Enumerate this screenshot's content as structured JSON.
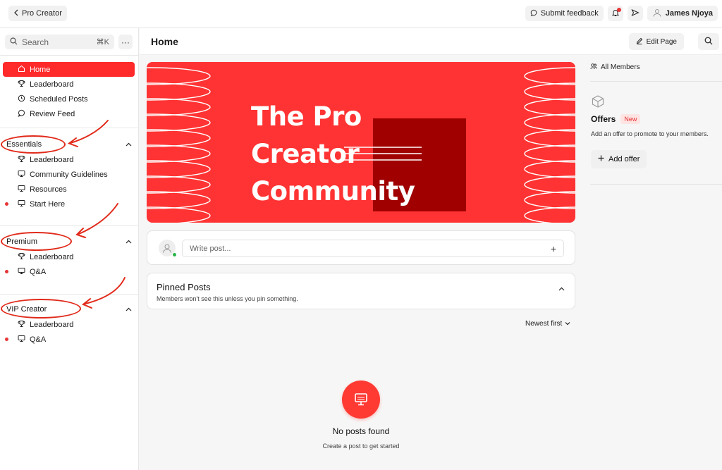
{
  "topbar": {
    "back_label": "Pro Creator",
    "feedback_label": "Submit feedback",
    "user_name": "James Njoya"
  },
  "sidebar": {
    "search_placeholder": "Search",
    "search_shortcut": "⌘K",
    "more_label": "···",
    "main_items": [
      {
        "label": "Home",
        "icon": "home-icon",
        "active": true
      },
      {
        "label": "Leaderboard",
        "icon": "trophy-icon"
      },
      {
        "label": "Scheduled Posts",
        "icon": "clock-icon"
      },
      {
        "label": "Review Feed",
        "icon": "chat-icon"
      }
    ],
    "sections": [
      {
        "title": "Essentials",
        "items": [
          {
            "label": "Leaderboard",
            "icon": "trophy-icon",
            "dot": false
          },
          {
            "label": "Community Guidelines",
            "icon": "monitor-icon",
            "dot": false
          },
          {
            "label": "Resources",
            "icon": "monitor-icon",
            "dot": false
          },
          {
            "label": "Start Here",
            "icon": "monitor-icon",
            "dot": true
          }
        ]
      },
      {
        "title": "Premium",
        "items": [
          {
            "label": "Leaderboard",
            "icon": "trophy-icon",
            "dot": false
          },
          {
            "label": "Q&A",
            "icon": "monitor-icon",
            "dot": true
          }
        ]
      },
      {
        "title": "VIP Creator",
        "items": [
          {
            "label": "Leaderboard",
            "icon": "trophy-icon",
            "dot": false
          },
          {
            "label": "Q&A",
            "icon": "monitor-icon",
            "dot": true
          }
        ]
      }
    ]
  },
  "main": {
    "page_title": "Home",
    "edit_label": "Edit Page",
    "banner": {
      "line1": "The Pro",
      "line2": "Creator",
      "line3": "Community"
    },
    "composer_placeholder": "Write post...",
    "composer_plus": "+",
    "pinned_title": "Pinned Posts",
    "pinned_sub": "Members won't see this unless you pin something.",
    "sort_label": "Newest first",
    "empty_title": "No posts found",
    "empty_sub": "Create a post to get started"
  },
  "right": {
    "all_members_label": "All Members",
    "offers_title": "Offers",
    "offers_badge": "New",
    "offers_sub": "Add an offer to promote to your members.",
    "add_offer_label": "Add offer"
  },
  "colors": {
    "accent": "#ff2a2a",
    "banner": "#ff3333",
    "banner_dark": "#a00000",
    "annotation": "#e12a1a"
  }
}
